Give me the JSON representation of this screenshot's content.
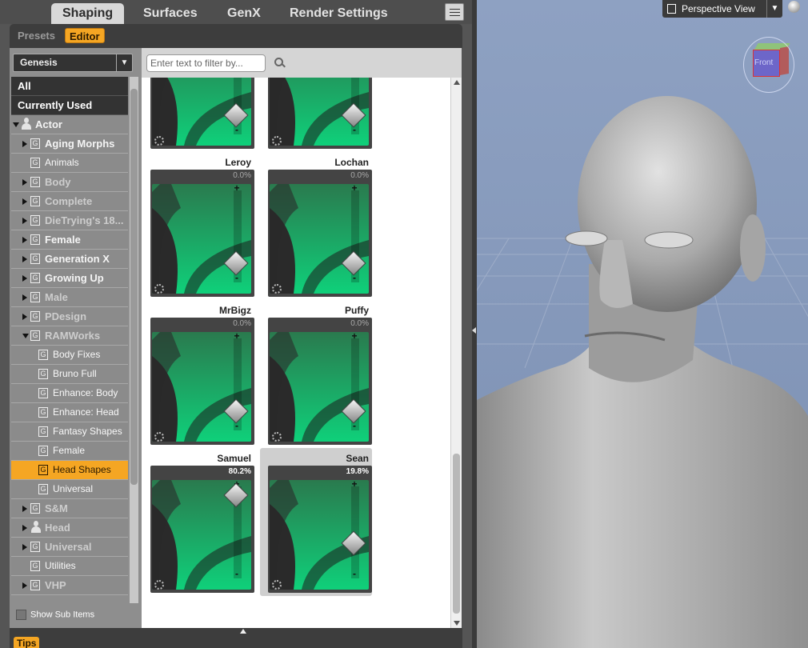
{
  "tabs": [
    "Shaping",
    "Surfaces",
    "GenX",
    "Render Settings"
  ],
  "active_tab": "Shaping",
  "subtabs": [
    "Presets",
    "Editor"
  ],
  "active_subtab": "Editor",
  "figure_select": "Genesis",
  "filter_placeholder": "Enter text to filter by...",
  "categories": [
    {
      "label": "All"
    },
    {
      "label": "Currently Used"
    },
    {
      "label": "Actor"
    },
    {
      "label": "Aging Morphs"
    },
    {
      "label": "Animals"
    },
    {
      "label": "Body"
    },
    {
      "label": "Complete"
    },
    {
      "label": "DieTrying's 18..."
    },
    {
      "label": "Female"
    },
    {
      "label": "Generation X"
    },
    {
      "label": "Growing Up"
    },
    {
      "label": "Male"
    },
    {
      "label": "PDesign"
    },
    {
      "label": "RAMWorks"
    },
    {
      "label": "Body Fixes"
    },
    {
      "label": "Bruno Full"
    },
    {
      "label": "Enhance: Body"
    },
    {
      "label": "Enhance: Head"
    },
    {
      "label": "Fantasy Shapes"
    },
    {
      "label": "Female"
    },
    {
      "label": "Head Shapes"
    },
    {
      "label": "Universal"
    },
    {
      "label": "S&M"
    },
    {
      "label": "Head"
    },
    {
      "label": "Universal"
    },
    {
      "label": "Utilities"
    },
    {
      "label": "VHP"
    }
  ],
  "show_sub_items": "Show Sub Items",
  "morphs": [
    {
      "name": "",
      "value": ""
    },
    {
      "name": "",
      "value": ""
    },
    {
      "name": "Leroy",
      "value": "0.0%"
    },
    {
      "name": "Lochan",
      "value": "0.0%"
    },
    {
      "name": "MrBigz",
      "value": "0.0%"
    },
    {
      "name": "Puffy",
      "value": "0.0%"
    },
    {
      "name": "Samuel",
      "value": "80.2%",
      "level": 0.802
    },
    {
      "name": "Sean",
      "value": "19.8%",
      "level": 0.198
    }
  ],
  "slider_plus": "+",
  "slider_minus": "-",
  "tips_label": "Tips",
  "viewport": {
    "view_label": "Perspective View",
    "cube_face": "Front"
  },
  "colors": {
    "accent": "#f5a623",
    "thumb_green": "#0fd07a",
    "viewport_bg": "#8ea1c2"
  }
}
